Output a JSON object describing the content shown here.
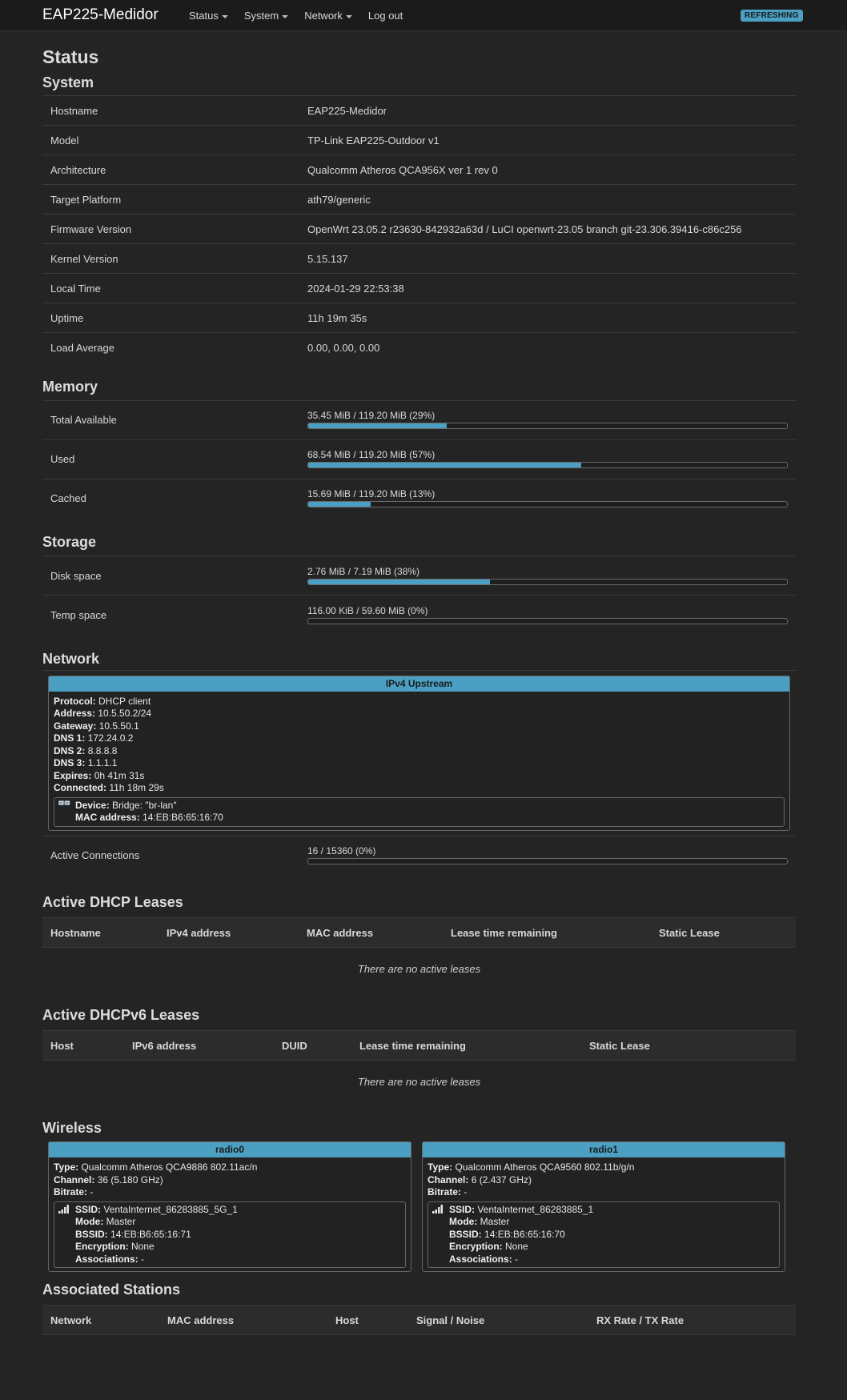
{
  "navbar": {
    "brand": "EAP225-Medidor",
    "menu": [
      {
        "label": "Status",
        "dropdown": true
      },
      {
        "label": "System",
        "dropdown": true
      },
      {
        "label": "Network",
        "dropdown": true
      },
      {
        "label": "Log out",
        "dropdown": false
      }
    ],
    "badge": "REFRESHING"
  },
  "page_title": "Status",
  "system": {
    "title": "System",
    "rows": [
      {
        "key": "Hostname",
        "value": "EAP225-Medidor"
      },
      {
        "key": "Model",
        "value": "TP-Link EAP225-Outdoor v1"
      },
      {
        "key": "Architecture",
        "value": "Qualcomm Atheros QCA956X ver 1 rev 0"
      },
      {
        "key": "Target Platform",
        "value": "ath79/generic"
      },
      {
        "key": "Firmware Version",
        "value": "OpenWrt 23.05.2 r23630-842932a63d / LuCI openwrt-23.05 branch git-23.306.39416-c86c256"
      },
      {
        "key": "Kernel Version",
        "value": "5.15.137"
      },
      {
        "key": "Local Time",
        "value": "2024-01-29 22:53:38"
      },
      {
        "key": "Uptime",
        "value": "11h 19m 35s"
      },
      {
        "key": "Load Average",
        "value": "0.00, 0.00, 0.00"
      }
    ]
  },
  "memory": {
    "title": "Memory",
    "rows": [
      {
        "key": "Total Available",
        "label": "35.45 MiB / 119.20 MiB (29%)",
        "percent": 29
      },
      {
        "key": "Used",
        "label": "68.54 MiB / 119.20 MiB (57%)",
        "percent": 57
      },
      {
        "key": "Cached",
        "label": "15.69 MiB / 119.20 MiB (13%)",
        "percent": 13
      }
    ]
  },
  "storage": {
    "title": "Storage",
    "rows": [
      {
        "key": "Disk space",
        "label": "2.76 MiB / 7.19 MiB (38%)",
        "percent": 38
      },
      {
        "key": "Temp space",
        "label": "116.00 KiB / 59.60 MiB (0%)",
        "percent": 0
      }
    ]
  },
  "network": {
    "title": "Network",
    "upstream_title": "IPv4 Upstream",
    "fields": [
      {
        "k": "Protocol:",
        "v": "DHCP client"
      },
      {
        "k": "Address:",
        "v": "10.5.50.2/24"
      },
      {
        "k": "Gateway:",
        "v": "10.5.50.1"
      },
      {
        "k": "DNS 1:",
        "v": "172.24.0.2"
      },
      {
        "k": "DNS 2:",
        "v": "8.8.8.8"
      },
      {
        "k": "DNS 3:",
        "v": "1.1.1.1"
      },
      {
        "k": "Expires:",
        "v": "0h 41m 31s"
      },
      {
        "k": "Connected:",
        "v": "11h 18m 29s"
      }
    ],
    "device_label": "Device:",
    "device_value": "Bridge: \"br-lan\"",
    "mac_label": "MAC address:",
    "mac_value": "14:EB:B6:65:16:70",
    "active_connections_key": "Active Connections",
    "active_connections_label": "16 / 15360 (0%)",
    "active_connections_percent": 0
  },
  "dhcp": {
    "title": "Active DHCP Leases",
    "columns": [
      "Hostname",
      "IPv4 address",
      "MAC address",
      "Lease time remaining",
      "Static Lease"
    ],
    "empty": "There are no active leases"
  },
  "dhcpv6": {
    "title": "Active DHCPv6 Leases",
    "columns": [
      "Host",
      "IPv6 address",
      "DUID",
      "Lease time remaining",
      "Static Lease"
    ],
    "empty": "There are no active leases"
  },
  "wireless": {
    "title": "Wireless",
    "radios": [
      {
        "name": "radio0",
        "type_label": "Type:",
        "type": "Qualcomm Atheros QCA9886 802.11ac/n",
        "channel_label": "Channel:",
        "channel": "36 (5.180 GHz)",
        "bitrate_label": "Bitrate:",
        "bitrate": "-",
        "ssid_label": "SSID:",
        "ssid": "VentaInternet_86283885_5G_1",
        "mode_label": "Mode:",
        "mode": "Master",
        "bssid_label": "BSSID:",
        "bssid": "14:EB:B6:65:16:71",
        "enc_label": "Encryption:",
        "encryption": "None",
        "assoc_label": "Associations:",
        "associations": "-"
      },
      {
        "name": "radio1",
        "type_label": "Type:",
        "type": "Qualcomm Atheros QCA9560 802.11b/g/n",
        "channel_label": "Channel:",
        "channel": "6 (2.437 GHz)",
        "bitrate_label": "Bitrate:",
        "bitrate": "-",
        "ssid_label": "SSID:",
        "ssid": "VentaInternet_86283885_1",
        "mode_label": "Mode:",
        "mode": "Master",
        "bssid_label": "BSSID:",
        "bssid": "14:EB:B6:65:16:70",
        "enc_label": "Encryption:",
        "encryption": "None",
        "assoc_label": "Associations:",
        "associations": "-"
      }
    ]
  },
  "stations": {
    "title": "Associated Stations",
    "columns": [
      "Network",
      "MAC address",
      "Host",
      "Signal / Noise",
      "RX Rate / TX Rate"
    ]
  },
  "colors": {
    "accent": "#4a9fc2",
    "background": "#242424",
    "navbar": "#1b1b1b"
  }
}
